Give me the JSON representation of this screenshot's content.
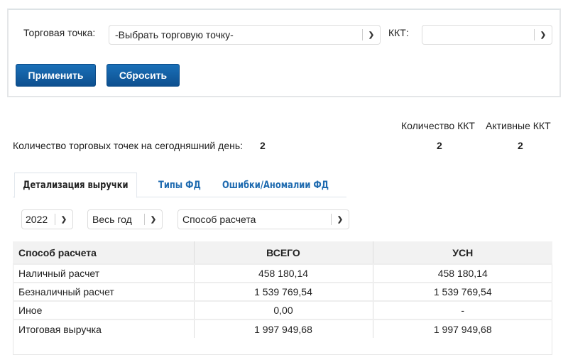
{
  "filters": {
    "store_label": "Торговая точка:",
    "store_value": "-Выбрать торговую точку-",
    "kkt_label": "ККТ:",
    "kkt_value": "",
    "apply": "Применить",
    "reset": "Сбросить"
  },
  "stats": {
    "kkt_count_label": "Количество ККТ",
    "active_kkt_label": "Активные ККТ",
    "stores_label": "Количество торговых точек на сегодняшний день:",
    "stores_value": "2",
    "kkt_count": "2",
    "active_kkt": "2"
  },
  "tabs": [
    "Детализация выручки",
    "Типы ФД",
    "Ошибки/Аномалии ФД"
  ],
  "controls": {
    "year": "2022",
    "period": "Весь год",
    "method": "Способ расчета"
  },
  "table": {
    "headers": [
      "Способ расчета",
      "ВСЕГО",
      "УСН"
    ],
    "rows": [
      [
        "Наличный расчет",
        "458 180,14",
        "458 180,14"
      ],
      [
        "Безналичный расчет",
        "1 539 769,54",
        "1 539 769,54"
      ],
      [
        "Иное",
        "0,00",
        "-"
      ],
      [
        "Итоговая выручка",
        "1 997 949,68",
        "1 997 949,68"
      ]
    ]
  }
}
